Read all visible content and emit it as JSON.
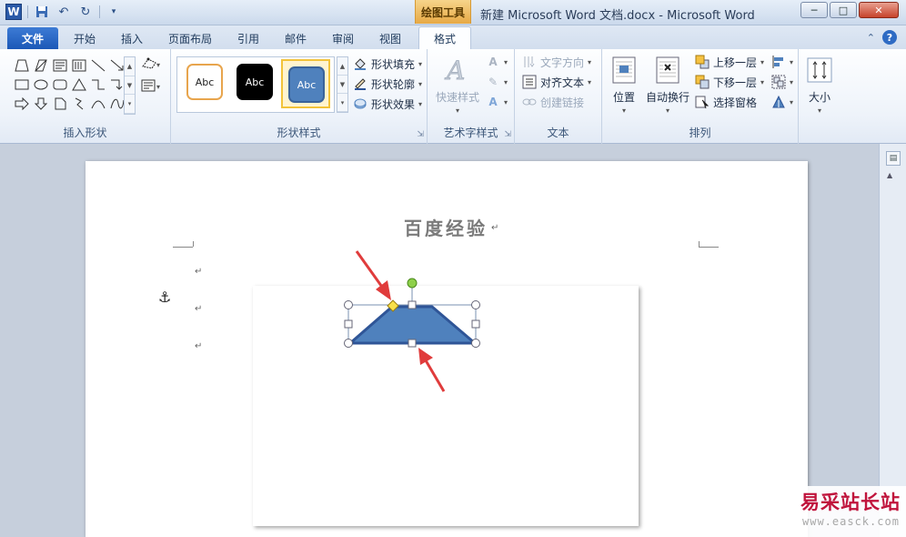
{
  "titlebar": {
    "tool_context": "绘图工具",
    "window_title": "新建 Microsoft Word 文档.docx  -  Microsoft Word",
    "minimize": "─",
    "maximize": "□",
    "close": "✕",
    "qat_icons": [
      "word-logo",
      "save-icon",
      "undo-icon",
      "redo-icon",
      "customize-icon"
    ]
  },
  "tabs": {
    "file": "文件",
    "home": "开始",
    "insert": "插入",
    "layout": "页面布局",
    "references": "引用",
    "mailings": "邮件",
    "review": "审阅",
    "view": "视图",
    "format": "格式"
  },
  "ribbon": {
    "insert_shapes": {
      "label": "插入形状"
    },
    "shape_styles": {
      "label": "形状样式",
      "swatches": [
        "Abc",
        "Abc",
        "Abc"
      ],
      "fill": "形状填充",
      "outline": "形状轮廓",
      "effects": "形状效果"
    },
    "wordart": {
      "label": "艺术字样式",
      "quick_styles": "快速样式"
    },
    "text": {
      "label": "文本",
      "direction": "文字方向",
      "align": "对齐文本",
      "link": "创建链接"
    },
    "arrange": {
      "label": "排列",
      "position": "位置",
      "wrap": "自动换行",
      "bring_forward": "上移一层",
      "send_backward": "下移一层",
      "selection_pane": "选择窗格"
    },
    "size": {
      "label": "大小"
    }
  },
  "document": {
    "title": "百度经验",
    "shape": {
      "type": "trapezoid",
      "fill": "#4f81bd",
      "stroke": "#2f5597"
    },
    "annotation_color": "#e03c3c",
    "accent": "#4f81bd"
  },
  "watermark": {
    "brand": "易采站长站",
    "url": "www.easck.com"
  }
}
